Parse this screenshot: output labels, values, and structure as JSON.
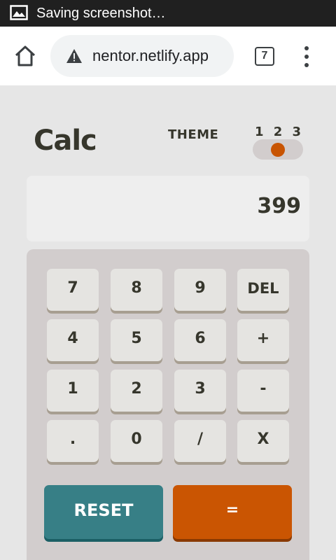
{
  "statusbar": {
    "text": "Saving screenshot…",
    "icon": "image-icon"
  },
  "browser": {
    "url": "nentor.netlify.app",
    "tab_count": "7",
    "icons": [
      "home-icon",
      "warning-icon",
      "tabs-icon",
      "menu-icon"
    ]
  },
  "calculator": {
    "logo": "Calc",
    "theme_label": "THEME",
    "theme_options": [
      "1",
      "2",
      "3"
    ],
    "selected_theme": "2",
    "display": "399",
    "keys": {
      "k7": "7",
      "k8": "8",
      "k9": "9",
      "del": "DEL",
      "k4": "4",
      "k5": "5",
      "k6": "6",
      "plus": "+",
      "k1": "1",
      "k2": "2",
      "k3": "3",
      "minus": "-",
      "dot": ".",
      "k0": "0",
      "divide": "/",
      "multiply": "X",
      "reset": "RESET",
      "equals": "="
    },
    "colors": {
      "background": "#e6e6e6",
      "keypad": "#d2cdcd",
      "key": "#e5e4e1",
      "reset": "#377f86",
      "equals": "#ca5502",
      "text": "#36362c"
    }
  }
}
